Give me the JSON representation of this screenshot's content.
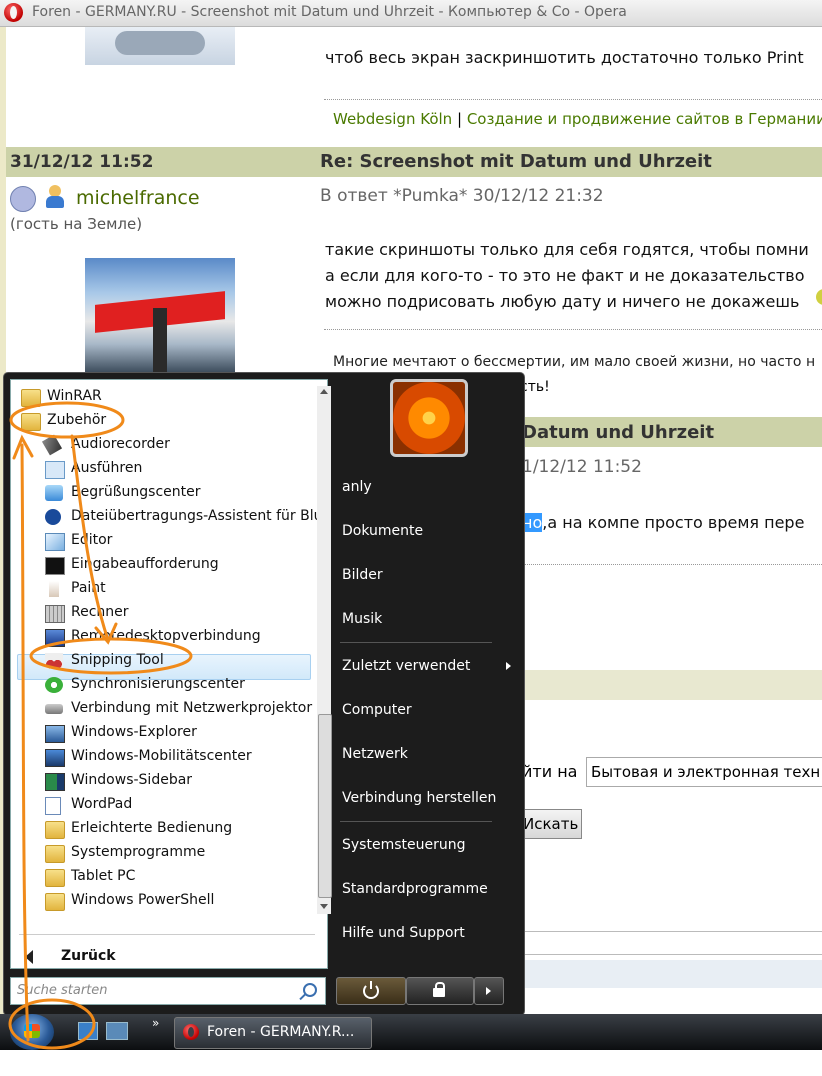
{
  "window": {
    "title": "Foren - GERMANY.RU - Screenshot mit Datum und Uhrzeit - Компьютер & Co - Opera"
  },
  "forum": {
    "top_text": "чтоб весь экран заскриншотить достаточно только Print",
    "signature1": {
      "link1": "Webdesign Köln",
      "separator": "|",
      "link2": "Создание и продвижение сайтов в Германии"
    },
    "post": {
      "date": "31/12/12 11:52",
      "subject": "Re: Screenshot mit Datum und Uhrzeit",
      "author": "michelfrance",
      "author_status": "(гость на Земле)",
      "reply_info": "В ответ *Pumka* 30/12/12 21:32",
      "body_lines": [
        "такие скриншоты только для себя годятся, чтобы помни",
        "а если для кого-то - то это не факт и не доказательство",
        "можно подрисовать любую дату и ничего не докажешь"
      ],
      "signature": "Многие мечтают о бессмертии, им мало своей жизни, но часто н"
    },
    "behind_menu": {
      "sig_fragment": "сть!",
      "subject_fragment": "Datum und Uhrzeit",
      "date_fragment": "1/12/12 11:52",
      "highlight": "но",
      "body_fragment": ",а на компе просто время пере",
      "search_label": "йти на",
      "search_value": "Бытовая и электронная техн",
      "search_button": "Искать"
    }
  },
  "start_menu": {
    "programs": [
      {
        "label": "WinRAR",
        "icon": "folder-icon"
      },
      {
        "label": "Zubehör",
        "icon": "folder-icon"
      },
      {
        "label": "Audiorecorder",
        "icon": "microphone-icon"
      },
      {
        "label": "Ausführen",
        "icon": "run-icon"
      },
      {
        "label": "Begrüßungscenter",
        "icon": "welcome-icon"
      },
      {
        "label": "Dateiübertragungs-Assistent für Blue",
        "icon": "bluetooth-icon"
      },
      {
        "label": "Editor",
        "icon": "notepad-icon"
      },
      {
        "label": "Eingabeaufforderung",
        "icon": "cmd-icon"
      },
      {
        "label": "Paint",
        "icon": "paint-icon"
      },
      {
        "label": "Rechner",
        "icon": "calculator-icon"
      },
      {
        "label": "Remotedesktopverbindung",
        "icon": "remote-desktop-icon"
      },
      {
        "label": "Snipping Tool",
        "icon": "scissors-icon"
      },
      {
        "label": "Synchronisierungscenter",
        "icon": "sync-icon"
      },
      {
        "label": "Verbindung mit Netzwerkprojektor",
        "icon": "projector-icon"
      },
      {
        "label": "Windows-Explorer",
        "icon": "explorer-icon"
      },
      {
        "label": "Windows-Mobilitätscenter",
        "icon": "mobility-icon"
      },
      {
        "label": "Windows-Sidebar",
        "icon": "sidebar-icon"
      },
      {
        "label": "WordPad",
        "icon": "wordpad-icon"
      },
      {
        "label": "Erleichterte Bedienung",
        "icon": "folder-icon"
      },
      {
        "label": "Systemprogramme",
        "icon": "folder-icon"
      },
      {
        "label": "Tablet PC",
        "icon": "folder-icon"
      },
      {
        "label": "Windows PowerShell",
        "icon": "folder-icon"
      }
    ],
    "selected_program": "Snipping Tool",
    "back_label": "Zurück",
    "search_placeholder": "Suche starten",
    "right_items": [
      "anly",
      "Dokumente",
      "Bilder",
      "Musik",
      "Zuletzt verwendet",
      "Computer",
      "Netzwerk",
      "Verbindung herstellen",
      "Systemsteuerung",
      "Standardprogramme",
      "Hilfe und Support"
    ]
  },
  "taskbar": {
    "more_glyph": "»",
    "task_label": "Foren - GERMANY.R..."
  },
  "colors": {
    "annotation": "#f08a1a",
    "post_header": "#ccd2a8",
    "link": "#4a7a00"
  }
}
